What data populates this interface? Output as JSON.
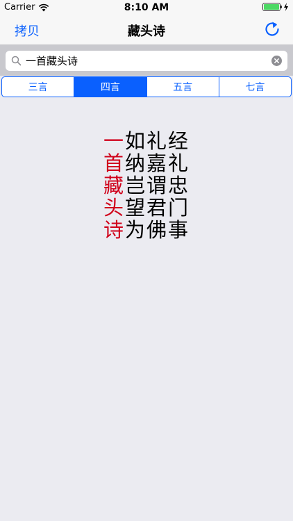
{
  "status": {
    "carrier": "Carrier",
    "time": "8:10 AM"
  },
  "nav": {
    "left_label": "拷贝",
    "title": "藏头诗"
  },
  "search": {
    "value": "一首藏头诗",
    "placeholder": ""
  },
  "segments": [
    "三言",
    "四言",
    "五言",
    "七言"
  ],
  "selected_segment": 1,
  "poem": {
    "lines": [
      {
        "head": "一",
        "rest": "如礼经"
      },
      {
        "head": "首",
        "rest": "纳嘉礼"
      },
      {
        "head": "藏",
        "rest": "岂谓忠"
      },
      {
        "head": "头",
        "rest": "望君门"
      },
      {
        "head": "诗",
        "rest": "为佛事"
      }
    ]
  },
  "colors": {
    "accent": "#0a60fe",
    "head_char": "#d0021b",
    "background": "#ebebf1",
    "battery": "#4cd964"
  },
  "icons": [
    "wifi-icon",
    "battery-icon",
    "charging-bolt-icon",
    "refresh-icon",
    "search-icon",
    "clear-icon"
  ]
}
